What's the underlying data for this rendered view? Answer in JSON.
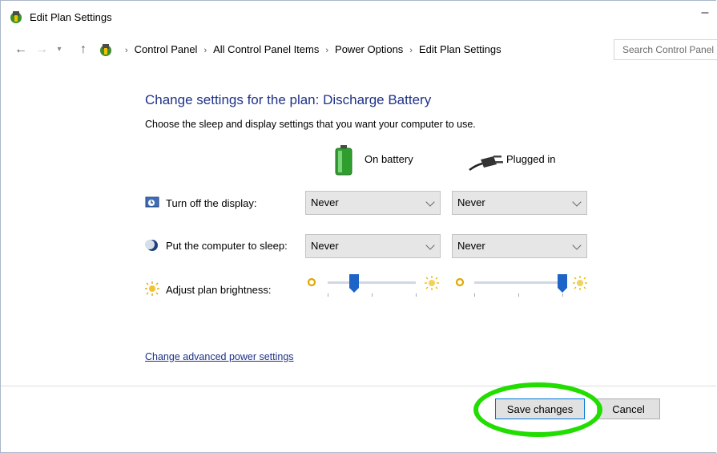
{
  "window": {
    "title": "Edit Plan Settings",
    "minimize_glyph": "–"
  },
  "navigation": {
    "back_glyph": "←",
    "forward_glyph": "→",
    "recent_glyph": "▾",
    "up_glyph": "↑",
    "breadcrumbs": [
      "Control Panel",
      "All Control Panel Items",
      "Power Options",
      "Edit Plan Settings"
    ],
    "separator": "›",
    "dropdown_glyph": "⌄",
    "refresh_glyph": "↻",
    "search_placeholder": "Search Control Panel"
  },
  "main": {
    "heading": "Change settings for the plan: Discharge Battery",
    "subheading": "Choose the sleep and display settings that you want your computer to use.",
    "columns": {
      "on_battery": "On battery",
      "plugged_in": "Plugged in"
    },
    "rows": {
      "display": {
        "label": "Turn off the display:",
        "on_battery": "Never",
        "plugged_in": "Never"
      },
      "sleep": {
        "label": "Put the computer to sleep:",
        "on_battery": "Never",
        "plugged_in": "Never"
      },
      "brightness": {
        "label": "Adjust plan brightness:",
        "on_battery_level": 0.3,
        "plugged_in_level": 1.0
      }
    },
    "advanced_link": "Change advanced power settings"
  },
  "footer": {
    "save_label": "Save changes",
    "cancel_label": "Cancel"
  },
  "colors": {
    "heading": "#1e3287",
    "highlight": "#22dd00",
    "slider_thumb": "#1e63c8",
    "battery": "#3cb043"
  },
  "icons": [
    "power-options-icon",
    "back-arrow-icon",
    "forward-arrow-icon",
    "up-arrow-icon",
    "refresh-icon",
    "battery-icon",
    "plug-icon",
    "clock-monitor-icon",
    "moon-icon",
    "sun-icon"
  ]
}
